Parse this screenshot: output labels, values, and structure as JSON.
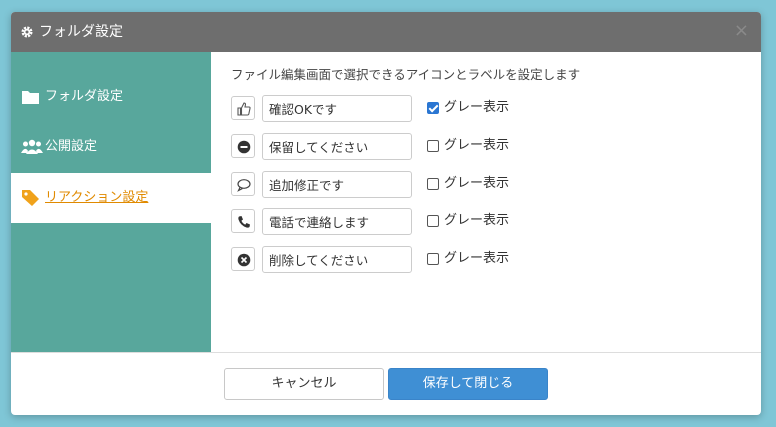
{
  "dialog": {
    "title": "フォルダ設定",
    "close_symbol": "×"
  },
  "sidebar": {
    "items": [
      {
        "label": "フォルダ設定",
        "icon": "folder-icon",
        "active": false
      },
      {
        "label": "公開設定",
        "icon": "users-icon",
        "active": false
      },
      {
        "label": "リアクション設定",
        "icon": "tag-icon",
        "active": true
      }
    ]
  },
  "main": {
    "description": "ファイル編集画面で選択できるアイコンとラベルを設定します",
    "reactions": [
      {
        "icon": "thumbs-up-icon",
        "label": "確認OKです",
        "gray_label": "グレー表示",
        "gray_checked": true
      },
      {
        "icon": "minus-circle-icon",
        "label": "保留してください",
        "gray_label": "グレー表示",
        "gray_checked": false
      },
      {
        "icon": "comment-icon",
        "label": "追加修正です",
        "gray_label": "グレー表示",
        "gray_checked": false
      },
      {
        "icon": "phone-icon",
        "label": "電話で連絡します",
        "gray_label": "グレー表示",
        "gray_checked": false
      },
      {
        "icon": "times-circle-icon",
        "label": "削除してください",
        "gray_label": "グレー表示",
        "gray_checked": false
      }
    ]
  },
  "footer": {
    "cancel_label": "キャンセル",
    "save_label": "保存して閉じる"
  },
  "colors": {
    "titlebar": "#6e6e6e",
    "sidebar": "#58a79c",
    "active_item": "#e08a00",
    "primary": "#3f8fd4",
    "background": "#7fc6d6"
  }
}
